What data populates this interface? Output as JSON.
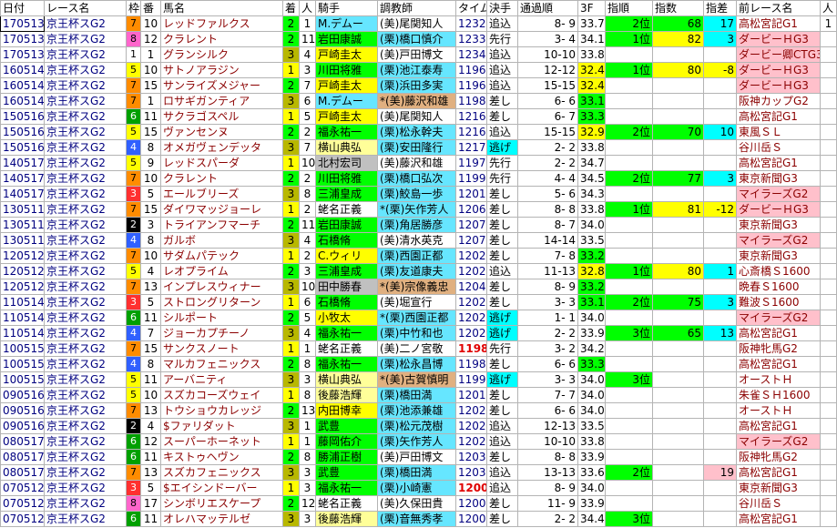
{
  "headers": [
    "日付",
    "レース名",
    "枠",
    "番",
    "馬名",
    "着",
    "人",
    "騎手",
    "調教師",
    "タイム",
    "決手",
    "通過順",
    "3F",
    "指順",
    "指数",
    "指差",
    "前レース名",
    "人",
    "着"
  ],
  "rows": [
    {
      "date": "170513",
      "race": "京王杯スG2",
      "waku": "7",
      "ban": "10",
      "horse": "レッドファルクス",
      "chaku": "2",
      "ninki": "1",
      "jockey": "M.デムー",
      "trainer": "(美)尾関知人",
      "time": "1232",
      "kime": "追込",
      "tsuka": "8- 9",
      "f3": "33.7",
      "rank": "2位",
      "shisu": "68",
      "sa": "17",
      "prev": "高松宮記G1",
      "prevnin": "1",
      "prevchaku": "1"
    },
    {
      "date": "170513",
      "race": "京王杯スG2",
      "waku": "8",
      "ban": "12",
      "horse": "クラレント",
      "chaku": "2",
      "ninki": "11",
      "jockey": "岩田康誠",
      "trainer": "(栗)橋口慎介",
      "time": "1233",
      "kime": "先行",
      "tsuka": "3- 4",
      "f3": "34.1",
      "rank": "1位",
      "shisu": "82",
      "sa": "3",
      "prev": "ダービーＨG3",
      "prevnin": "",
      "prevchaku": ""
    },
    {
      "date": "170513",
      "race": "京王杯スG2",
      "waku": "1",
      "ban": "1",
      "horse": "グランシルク",
      "chaku": "3",
      "ninki": "4",
      "jockey": "戸崎圭太",
      "trainer": "(美)戸田博文",
      "time": "1234",
      "kime": "追込",
      "tsuka": "10-10",
      "f3": "33.8",
      "rank": "",
      "shisu": "",
      "sa": "",
      "prev": "ダービー卿CTG3",
      "prevnin": "",
      "prevchaku": ""
    },
    {
      "date": "160514",
      "race": "京王杯スG2",
      "waku": "5",
      "ban": "10",
      "horse": "サトノアラジン",
      "chaku": "1",
      "ninki": "3",
      "jockey": "川田将雅",
      "trainer": "(栗)池江泰寿",
      "time": "1196",
      "kime": "追込",
      "tsuka": "12-12",
      "f3": "32.4",
      "rank": "1位",
      "shisu": "80",
      "sa": "-8",
      "prev": "ダービーＨG3",
      "prevnin": "",
      "prevchaku": ""
    },
    {
      "date": "160514",
      "race": "京王杯スG2",
      "waku": "7",
      "ban": "15",
      "horse": "サンライズメジャー",
      "chaku": "2",
      "ninki": "7",
      "jockey": "戸崎圭太",
      "trainer": "(栗)浜田多実",
      "time": "1196",
      "kime": "追込",
      "tsuka": "15-15",
      "f3": "32.4",
      "rank": "",
      "shisu": "",
      "sa": "",
      "prev": "ダービーＨG3",
      "prevnin": "",
      "prevchaku": ""
    },
    {
      "date": "160514",
      "race": "京王杯スG2",
      "waku": "7",
      "ban": "1",
      "horse": "ロサギガンティア",
      "chaku": "3",
      "ninki": "6",
      "jockey": "M.デムー",
      "trainer": "*(美)藤沢和雄",
      "time": "1198",
      "kime": "差し",
      "tsuka": "6- 6",
      "f3": "33.1",
      "rank": "",
      "shisu": "",
      "sa": "",
      "prev": "阪神カップG2",
      "prevnin": "",
      "prevchaku": ""
    },
    {
      "date": "150516",
      "race": "京王杯スG2",
      "waku": "6",
      "ban": "11",
      "horse": "サクラゴスペル",
      "chaku": "1",
      "ninki": "5",
      "jockey": "戸崎圭太",
      "trainer": "(美)尾関知人",
      "time": "1216",
      "kime": "差し",
      "tsuka": "6- 7",
      "f3": "33.3",
      "rank": "",
      "shisu": "",
      "sa": "",
      "prev": "高松宮記G1",
      "prevnin": "",
      "prevchaku": ""
    },
    {
      "date": "150516",
      "race": "京王杯スG2",
      "waku": "5",
      "ban": "15",
      "horse": "ヴァンセンヌ",
      "chaku": "2",
      "ninki": "2",
      "jockey": "福永祐一",
      "trainer": "(栗)松永幹夫",
      "time": "1216",
      "kime": "追込",
      "tsuka": "15-15",
      "f3": "32.9",
      "rank": "2位",
      "shisu": "70",
      "sa": "10",
      "prev": "東風ＳＬ",
      "prevnin": "",
      "prevchaku": ""
    },
    {
      "date": "150516",
      "race": "京王杯スG2",
      "waku": "4",
      "ban": "8",
      "horse": "オメガヴェンデッタ",
      "chaku": "3",
      "ninki": "7",
      "jockey": "横山典弘",
      "trainer": "(栗)安田隆行",
      "time": "1217",
      "kime": "逃げ",
      "tsuka": "2- 2",
      "f3": "33.8",
      "rank": "",
      "shisu": "",
      "sa": "",
      "prev": "谷川岳Ｓ",
      "prevnin": "",
      "prevchaku": ""
    },
    {
      "date": "140517",
      "race": "京王杯スG2",
      "waku": "5",
      "ban": "9",
      "horse": "レッドスパーダ",
      "chaku": "1",
      "ninki": "10",
      "jockey": "北村宏司",
      "trainer": "(美)藤沢和雄",
      "time": "1197",
      "kime": "先行",
      "tsuka": "2- 2",
      "f3": "34.7",
      "rank": "",
      "shisu": "",
      "sa": "",
      "prev": "高松宮記G1",
      "prevnin": "",
      "prevchaku": ""
    },
    {
      "date": "140517",
      "race": "京王杯スG2",
      "waku": "7",
      "ban": "10",
      "horse": "クラレント",
      "chaku": "2",
      "ninki": "2",
      "jockey": "川田将雅",
      "trainer": "(栗)橋口弘次",
      "time": "1199",
      "kime": "先行",
      "tsuka": "4- 4",
      "f3": "34.5",
      "rank": "2位",
      "shisu": "77",
      "sa": "3",
      "prev": "東京新聞G3",
      "prevnin": "",
      "prevchaku": ""
    },
    {
      "date": "140517",
      "race": "京王杯スG2",
      "waku": "3",
      "ban": "5",
      "horse": "エールブリーズ",
      "chaku": "3",
      "ninki": "8",
      "jockey": "三浦皇成",
      "trainer": "(栗)鮫島一歩",
      "time": "1201",
      "kime": "差し",
      "tsuka": "5- 6",
      "f3": "34.3",
      "rank": "",
      "shisu": "",
      "sa": "",
      "prev": "マイラーズG2",
      "prevnin": "",
      "prevchaku": ""
    },
    {
      "date": "130511",
      "race": "京王杯スG2",
      "waku": "7",
      "ban": "15",
      "horse": "ダイワマッジョーレ",
      "chaku": "1",
      "ninki": "2",
      "jockey": "蛯名正義",
      "trainer": "*(栗)矢作芳人",
      "time": "1206",
      "kime": "差し",
      "tsuka": "8- 8",
      "f3": "33.8",
      "rank": "1位",
      "shisu": "81",
      "sa": "-12",
      "prev": "ダービーＨG3",
      "prevnin": "",
      "prevchaku": ""
    },
    {
      "date": "130511",
      "race": "京王杯スG2",
      "waku": "2",
      "ban": "3",
      "horse": "トライアンフマーチ",
      "chaku": "2",
      "ninki": "11",
      "jockey": "岩田康誠",
      "trainer": "(栗)角居勝彦",
      "time": "1207",
      "kime": "差し",
      "tsuka": "8- 7",
      "f3": "34.0",
      "rank": "",
      "shisu": "",
      "sa": "",
      "prev": "東京新聞G3",
      "prevnin": "",
      "prevchaku": ""
    },
    {
      "date": "130511",
      "race": "京王杯スG2",
      "waku": "4",
      "ban": "8",
      "horse": "ガルボ",
      "chaku": "3",
      "ninki": "4",
      "jockey": "石橋脩",
      "trainer": "(美)清水英克",
      "time": "1207",
      "kime": "差し",
      "tsuka": "14-14",
      "f3": "33.5",
      "rank": "",
      "shisu": "",
      "sa": "",
      "prev": "マイラーズG2",
      "prevnin": "",
      "prevchaku": ""
    },
    {
      "date": "120512",
      "race": "京王杯スG2",
      "waku": "7",
      "ban": "10",
      "horse": "サダムパテック",
      "chaku": "1",
      "ninki": "2",
      "jockey": "C.ウィリ",
      "trainer": "(栗)西園正都",
      "time": "1202",
      "kime": "差し",
      "tsuka": "7- 8",
      "f3": "33.2",
      "rank": "",
      "shisu": "",
      "sa": "",
      "prev": "東京新聞G3",
      "prevnin": "",
      "prevchaku": ""
    },
    {
      "date": "120512",
      "race": "京王杯スG2",
      "waku": "5",
      "ban": "4",
      "horse": "レオプライム",
      "chaku": "2",
      "ninki": "3",
      "jockey": "三浦皇成",
      "trainer": "(栗)友道康夫",
      "time": "1202",
      "kime": "追込",
      "tsuka": "11-13",
      "f3": "32.8",
      "rank": "1位",
      "shisu": "80",
      "sa": "1",
      "prev": "心斎橋Ｓ1600",
      "prevnin": "",
      "prevchaku": ""
    },
    {
      "date": "120512",
      "race": "京王杯スG2",
      "waku": "7",
      "ban": "13",
      "horse": "インプレスウィナー",
      "chaku": "3",
      "ninki": "10",
      "jockey": "田中勝春",
      "trainer": "*(美)宗像義忠",
      "time": "1204",
      "kime": "差し",
      "tsuka": "8- 9",
      "f3": "33.2",
      "rank": "",
      "shisu": "",
      "sa": "",
      "prev": "晩春Ｓ1600",
      "prevnin": "",
      "prevchaku": ""
    },
    {
      "date": "110514",
      "race": "京王杯スG2",
      "waku": "3",
      "ban": "5",
      "horse": "ストロングリターン",
      "chaku": "1",
      "ninki": "6",
      "jockey": "石橋脩",
      "trainer": "(美)堀宣行",
      "time": "1202",
      "kime": "差し",
      "tsuka": "3- 3",
      "f3": "33.1",
      "rank": "2位",
      "shisu": "75",
      "sa": "3",
      "prev": "難波Ｓ1600",
      "prevnin": "",
      "prevchaku": ""
    },
    {
      "date": "110514",
      "race": "京王杯スG2",
      "waku": "6",
      "ban": "11",
      "horse": "シルポート",
      "chaku": "2",
      "ninki": "5",
      "jockey": "小牧太",
      "trainer": "*(栗)西園正都",
      "time": "1202",
      "kime": "逃げ",
      "tsuka": "1- 1",
      "f3": "34.0",
      "rank": "",
      "shisu": "",
      "sa": "",
      "prev": "マイラーズG2",
      "prevnin": "",
      "prevchaku": ""
    },
    {
      "date": "110514",
      "race": "京王杯スG2",
      "waku": "4",
      "ban": "7",
      "horse": "ジョーカプチーノ",
      "chaku": "3",
      "ninki": "4",
      "jockey": "福永祐一",
      "trainer": "(栗)中竹和也",
      "time": "1202",
      "kime": "逃げ",
      "tsuka": "2- 2",
      "f3": "33.9",
      "rank": "3位",
      "shisu": "65",
      "sa": "13",
      "prev": "高松宮記G1",
      "prevnin": "",
      "prevchaku": ""
    },
    {
      "date": "100515",
      "race": "京王杯スG2",
      "waku": "7",
      "ban": "15",
      "horse": "サンクスノート",
      "chaku": "1",
      "ninki": "1",
      "jockey": "蛯名正義",
      "trainer": "(美)二ノ宮敬",
      "time": "1198",
      "kime": "先行",
      "tsuka": "3- 2",
      "f3": "34.2",
      "rank": "",
      "shisu": "",
      "sa": "",
      "prev": "阪神牝馬G2",
      "prevnin": "",
      "prevchaku": ""
    },
    {
      "date": "100515",
      "race": "京王杯スG2",
      "waku": "4",
      "ban": "8",
      "horse": "マルカフェニックス",
      "chaku": "2",
      "ninki": "8",
      "jockey": "福永祐一",
      "trainer": "(栗)松永昌博",
      "time": "1198",
      "kime": "差し",
      "tsuka": "6- 6",
      "f3": "33.3",
      "rank": "",
      "shisu": "",
      "sa": "",
      "prev": "高松宮記G1",
      "prevnin": "",
      "prevchaku": ""
    },
    {
      "date": "100515",
      "race": "京王杯スG2",
      "waku": "5",
      "ban": "11",
      "horse": "アーバニティ",
      "chaku": "3",
      "ninki": "3",
      "jockey": "横山典弘",
      "trainer": "*(美)古賀慎明",
      "time": "1199",
      "kime": "逃げ",
      "tsuka": "3- 3",
      "f3": "34.0",
      "rank": "3位",
      "shisu": "",
      "sa": "",
      "prev": "オーストＨ",
      "prevnin": "",
      "prevchaku": ""
    },
    {
      "date": "090516",
      "race": "京王杯スG2",
      "waku": "5",
      "ban": "10",
      "horse": "スズカコーズウェイ",
      "chaku": "1",
      "ninki": "8",
      "jockey": "後藤浩輝",
      "trainer": "(栗)橋田満",
      "time": "1201",
      "kime": "差し",
      "tsuka": "7- 7",
      "f3": "34.0",
      "rank": "",
      "shisu": "",
      "sa": "",
      "prev": "朱雀ＳＨ1600",
      "prevnin": "",
      "prevchaku": ""
    },
    {
      "date": "090516",
      "race": "京王杯スG2",
      "waku": "7",
      "ban": "13",
      "horse": "トウショウカレッジ",
      "chaku": "2",
      "ninki": "13",
      "jockey": "内田博幸",
      "trainer": "(栗)池添兼雄",
      "time": "1202",
      "kime": "差し",
      "tsuka": "6- 6",
      "f3": "34.0",
      "rank": "",
      "shisu": "",
      "sa": "",
      "prev": "オーストＨ",
      "prevnin": "",
      "prevchaku": ""
    },
    {
      "date": "090516",
      "race": "京王杯スG2",
      "waku": "2",
      "ban": "4",
      "horse": "$ファリダット",
      "chaku": "3",
      "ninki": "1",
      "jockey": "武豊",
      "trainer": "(栗)松元茂樹",
      "time": "1202",
      "kime": "追込",
      "tsuka": "12-13",
      "f3": "33.5",
      "rank": "",
      "shisu": "",
      "sa": "",
      "prev": "高松宮記G1",
      "prevnin": "",
      "prevchaku": ""
    },
    {
      "date": "080517",
      "race": "京王杯スG2",
      "waku": "6",
      "ban": "12",
      "horse": "スーパーホーネット",
      "chaku": "1",
      "ninki": "1",
      "jockey": "藤岡佑介",
      "trainer": "(栗)矢作芳人",
      "time": "1202",
      "kime": "追込",
      "tsuka": "10-10",
      "f3": "33.8",
      "rank": "",
      "shisu": "",
      "sa": "",
      "prev": "マイラーズG2",
      "prevnin": "",
      "prevchaku": ""
    },
    {
      "date": "080517",
      "race": "京王杯スG2",
      "waku": "6",
      "ban": "11",
      "horse": "キストゥヘヴン",
      "chaku": "2",
      "ninki": "8",
      "jockey": "勝浦正樹",
      "trainer": "(美)戸田博文",
      "time": "1203",
      "kime": "差し",
      "tsuka": "8- 8",
      "f3": "33.9",
      "rank": "",
      "shisu": "",
      "sa": "",
      "prev": "阪神牝馬G2",
      "prevnin": "",
      "prevchaku": ""
    },
    {
      "date": "080517",
      "race": "京王杯スG2",
      "waku": "7",
      "ban": "13",
      "horse": "スズカフェニックス",
      "chaku": "3",
      "ninki": "3",
      "jockey": "武豊",
      "trainer": "(栗)橋田満",
      "time": "1203",
      "kime": "追込",
      "tsuka": "13-13",
      "f3": "33.6",
      "rank": "2位",
      "shisu": "",
      "sa": "19",
      "prev": "高松宮記G1",
      "prevnin": "",
      "prevchaku": ""
    },
    {
      "date": "070512",
      "race": "京王杯スG2",
      "waku": "3",
      "ban": "5",
      "horse": "$エイシンドーバー",
      "chaku": "1",
      "ninki": "3",
      "jockey": "福永祐一",
      "trainer": "(栗)小崎憲",
      "time": "1200",
      "kime": "追込",
      "tsuka": "8- 9",
      "f3": "34.0",
      "rank": "",
      "shisu": "",
      "sa": "",
      "prev": "東京新聞G3",
      "prevnin": "",
      "prevchaku": ""
    },
    {
      "date": "070512",
      "race": "京王杯スG2",
      "waku": "8",
      "ban": "17",
      "horse": "シンボリエスケープ",
      "chaku": "2",
      "ninki": "12",
      "jockey": "蛯名正義",
      "trainer": "(美)久保田貴",
      "time": "1200",
      "kime": "差し",
      "tsuka": "11- 9",
      "f3": "33.9",
      "rank": "",
      "shisu": "",
      "sa": "",
      "prev": "谷川岳Ｓ",
      "prevnin": "",
      "prevchaku": ""
    },
    {
      "date": "070512",
      "race": "京王杯スG2",
      "waku": "6",
      "ban": "11",
      "horse": "オレハマッテルゼ",
      "chaku": "3",
      "ninki": "3",
      "jockey": "後藤浩輝",
      "trainer": "(栗)音無秀孝",
      "time": "1200",
      "kime": "差し",
      "tsuka": "2- 2",
      "f3": "34.4",
      "rank": "3位",
      "shisu": "",
      "sa": "",
      "prev": "高松宮記G1",
      "prevnin": "",
      "prevchaku": ""
    }
  ],
  "colors": {
    "accent_mark": "#e00000",
    "horse_text": "#8b0000",
    "race_text": "#000080"
  }
}
